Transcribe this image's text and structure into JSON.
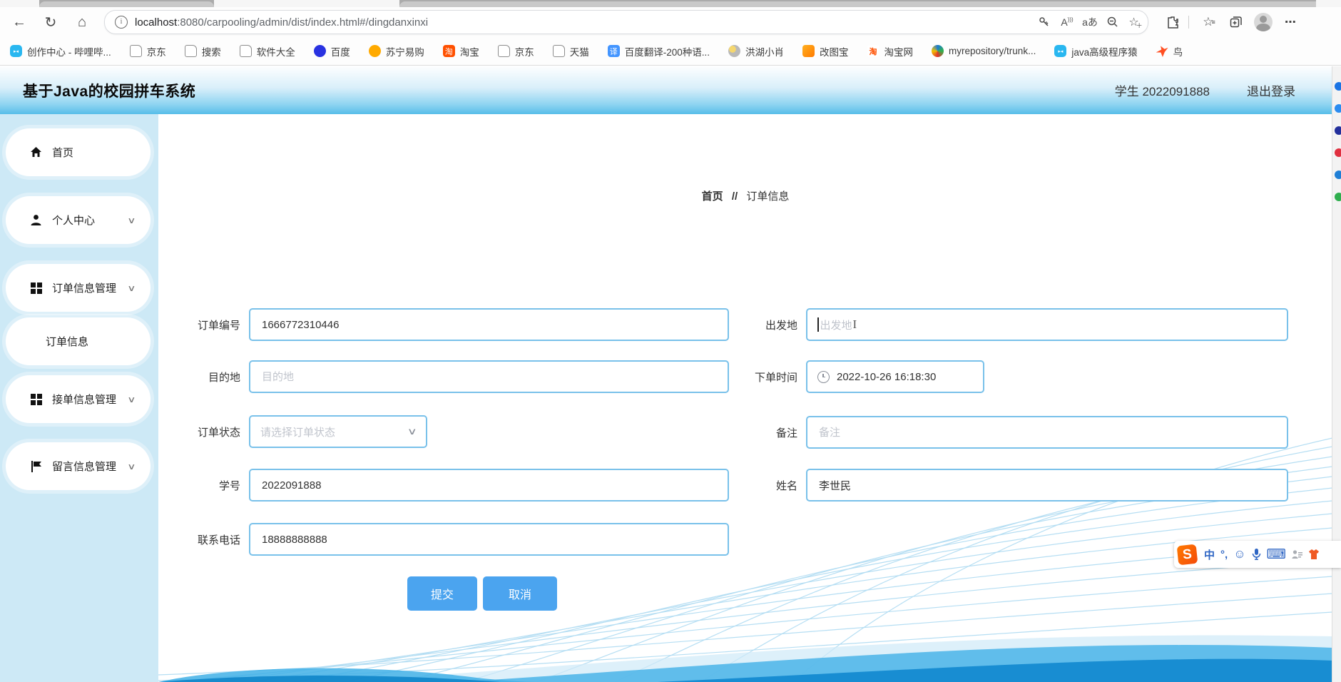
{
  "browser": {
    "url_host": "localhost",
    "url_rest": ":8080/carpooling/admin/dist/index.html#/dingdanxinxi",
    "bookmarks": [
      {
        "label": "创作中心 - 哔哩哔...",
        "icon": "bilibili",
        "glyph": ""
      },
      {
        "label": "京东",
        "icon": "file",
        "glyph": ""
      },
      {
        "label": "搜索",
        "icon": "file",
        "glyph": ""
      },
      {
        "label": "软件大全",
        "icon": "file",
        "glyph": ""
      },
      {
        "label": "百度",
        "icon": "baidu",
        "glyph": ""
      },
      {
        "label": "苏宁易购",
        "icon": "suning",
        "glyph": ""
      },
      {
        "label": "淘宝",
        "icon": "taobao",
        "glyph": "淘"
      },
      {
        "label": "京东",
        "icon": "file",
        "glyph": ""
      },
      {
        "label": "天猫",
        "icon": "file",
        "glyph": ""
      },
      {
        "label": "百度翻译-200种语...",
        "icon": "fanyi",
        "glyph": "译"
      },
      {
        "label": "洪湖小肖",
        "icon": "honghu",
        "glyph": ""
      },
      {
        "label": "改图宝",
        "icon": "gaitubao",
        "glyph": ""
      },
      {
        "label": "淘宝网",
        "icon": "taobao-web",
        "glyph": "淘"
      },
      {
        "label": "myrepository/trunk...",
        "icon": "myrepo",
        "glyph": ""
      },
      {
        "label": "java高级程序猿",
        "icon": "bilibili",
        "glyph": ""
      },
      {
        "label": "鸟",
        "icon": "bird",
        "glyph": ""
      }
    ],
    "edge_strip_colors": [
      "#1b74e4",
      "#2a8cf0",
      "#23309c",
      "#e03040",
      "#1f7fd6",
      "#2fae4e"
    ]
  },
  "header": {
    "title": "基于Java的校园拼车系统",
    "user": "学生 2022091888",
    "logout_label": "退出登录"
  },
  "sidebar": {
    "items": [
      {
        "label": "首页"
      },
      {
        "label": "个人中心"
      },
      {
        "label": "订单信息管理"
      },
      {
        "label": "订单信息"
      },
      {
        "label": "接单信息管理"
      },
      {
        "label": "留言信息管理"
      }
    ]
  },
  "breadcrumb": {
    "home": "首页",
    "separator": "//",
    "current": "订单信息"
  },
  "form": {
    "left": [
      {
        "label": "订单编号",
        "value": "1666772310446"
      },
      {
        "label": "目的地",
        "placeholder": "目的地"
      },
      {
        "label": "订单状态",
        "placeholder": "请选择订单状态"
      },
      {
        "label": "学号",
        "value": "2022091888"
      },
      {
        "label": "联系电话",
        "value": "18888888888"
      }
    ],
    "right": [
      {
        "label": "出发地",
        "placeholder": "出发地"
      },
      {
        "label": "下单时间",
        "value": "2022-10-26 16:18:30"
      },
      {
        "label": "备注",
        "placeholder": "备注"
      },
      {
        "label": "姓名",
        "value": "李世民"
      }
    ],
    "submit_label": "提交",
    "cancel_label": "取消"
  },
  "ime": {
    "mode": "中",
    "punct": "°,",
    "emoji": "☺",
    "keyboard": "⌨"
  },
  "colors": {
    "accent_button": "#4ba4ef",
    "input_border": "#79c1ea",
    "header_gradient_bottom": "#57bde9",
    "sidebar_bg": "#cde9f6",
    "wave_light": "#9dd3ef",
    "wave_mid": "#52b7e9",
    "wave_dark": "#1289cf"
  }
}
